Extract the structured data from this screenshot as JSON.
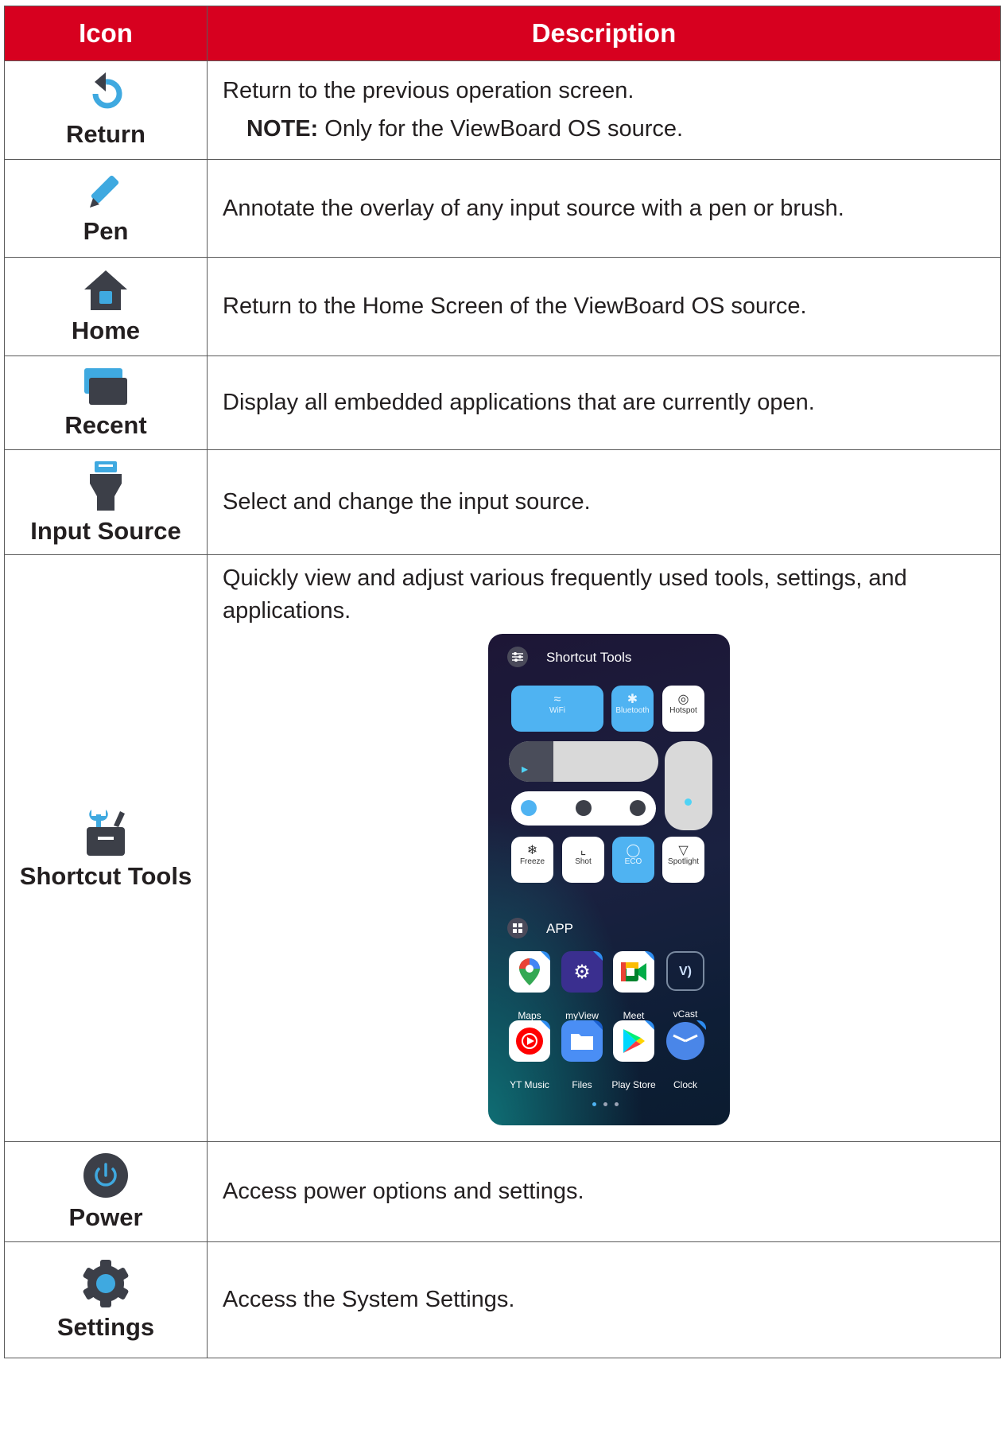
{
  "table": {
    "header_icon": "Icon",
    "header_description": "Description",
    "rows": [
      {
        "icon_name": "return-icon",
        "label": "Return",
        "description": "Return to the previous operation screen.",
        "note_label": "NOTE:",
        "note_text": " Only for the ViewBoard OS source."
      },
      {
        "icon_name": "pen-icon",
        "label": "Pen",
        "description": "Annotate the overlay of any input source with a pen or brush."
      },
      {
        "icon_name": "home-icon",
        "label": "Home",
        "description": "Return to the Home Screen of the ViewBoard OS source."
      },
      {
        "icon_name": "recent-icon",
        "label": "Recent",
        "description": "Display all embedded applications that are currently open."
      },
      {
        "icon_name": "input-source-icon",
        "label": "Input Source",
        "description": "Select and change the input source."
      },
      {
        "icon_name": "shortcut-tools-icon",
        "label": "Shortcut Tools",
        "description": "Quickly view and adjust various frequently used tools, settings, and applications."
      },
      {
        "icon_name": "power-icon",
        "label": "Power",
        "description": "Access power options and settings."
      },
      {
        "icon_name": "settings-icon",
        "label": "Settings",
        "description": "Access the System Settings."
      }
    ]
  },
  "shortcut_panel": {
    "title": "Shortcut Tools",
    "toggles": [
      {
        "label": "WiFi",
        "active": true
      },
      {
        "label": "Bluetooth",
        "active": true
      },
      {
        "label": "Hotspot",
        "active": false
      }
    ],
    "volume_level": 0.3,
    "brightness_level": 1.0,
    "tools": [
      {
        "label": "Freeze",
        "active": false
      },
      {
        "label": "Shot",
        "active": false
      },
      {
        "label": "ECO",
        "active": true
      },
      {
        "label": "Spotlight",
        "active": false
      }
    ],
    "apps_title": "APP",
    "apps": [
      "Maps",
      "myView",
      "Meet",
      "vCast",
      "YT Music",
      "Files",
      "Play Store",
      "Clock"
    ],
    "page_dots": 3
  },
  "colors": {
    "header_red": "#d7001f",
    "icon_blue": "#3fa9e0",
    "icon_dark": "#3c3f48"
  }
}
